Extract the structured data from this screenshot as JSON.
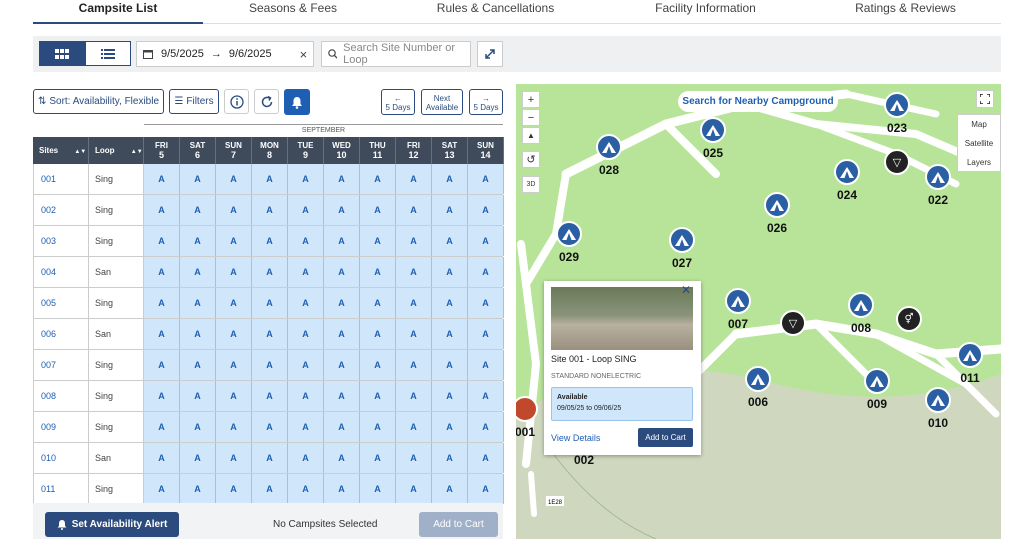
{
  "tabs": [
    "Campsite List",
    "Seasons & Fees",
    "Rules & Cancellations",
    "Facility Information",
    "Ratings & Reviews"
  ],
  "dates": {
    "start": "9/5/2025",
    "end": "9/6/2025"
  },
  "search": {
    "placeholder": "Search Site Number or Loop"
  },
  "controls": {
    "sort": "Sort: Availability, Flexible",
    "filters": "Filters",
    "prev": "← 5 Days",
    "next_available": "Next Available",
    "next": "→ 5 Days",
    "prev_a": "←",
    "prev_b": "5 Days",
    "next_av_a": "Next",
    "next_av_b": "Available",
    "next_a": "→",
    "next_b": "5 Days"
  },
  "month": "SEPTEMBER",
  "columns": {
    "sites": "Sites",
    "loop": "Loop"
  },
  "days": [
    {
      "d": "FRI",
      "n": "5"
    },
    {
      "d": "SAT",
      "n": "6"
    },
    {
      "d": "SUN",
      "n": "7"
    },
    {
      "d": "MON",
      "n": "8"
    },
    {
      "d": "TUE",
      "n": "9"
    },
    {
      "d": "WED",
      "n": "10"
    },
    {
      "d": "THU",
      "n": "11"
    },
    {
      "d": "FRI",
      "n": "12"
    },
    {
      "d": "SAT",
      "n": "13"
    },
    {
      "d": "SUN",
      "n": "14"
    }
  ],
  "rows": [
    {
      "site": "001",
      "loop": "Sing"
    },
    {
      "site": "002",
      "loop": "Sing"
    },
    {
      "site": "003",
      "loop": "Sing"
    },
    {
      "site": "004",
      "loop": "San"
    },
    {
      "site": "005",
      "loop": "Sing"
    },
    {
      "site": "006",
      "loop": "San"
    },
    {
      "site": "007",
      "loop": "Sing"
    },
    {
      "site": "008",
      "loop": "Sing"
    },
    {
      "site": "009",
      "loop": "Sing"
    },
    {
      "site": "010",
      "loop": "San"
    },
    {
      "site": "011",
      "loop": "Sing"
    }
  ],
  "avail_mark": "A",
  "footer": {
    "alert": "Set Availability Alert",
    "selected": "No Campsites Selected",
    "cart": "Add to Cart"
  },
  "map": {
    "search_nearby": "Search for Nearby Campground",
    "layers": [
      "Map",
      "Satellite",
      "Layers"
    ],
    "mode3d": "3D",
    "pins": [
      "023",
      "025",
      "028",
      "024",
      "022",
      "026",
      "029",
      "027",
      "007",
      "008",
      "011",
      "006",
      "009",
      "010",
      "001",
      "002"
    ],
    "road_label": "1E28"
  },
  "popup": {
    "title": "Site 001 - Loop SING",
    "type": "STANDARD NONELECTRIC",
    "status": "Available",
    "range": "09/05/25 to 09/06/25",
    "details": "View Details",
    "cart": "Add to Cart"
  },
  "colors": {
    "primary": "#2b4b7e",
    "available": "#cfe6fb",
    "map_green": "#b8e49a",
    "pin_blue": "#2b5fa3"
  }
}
